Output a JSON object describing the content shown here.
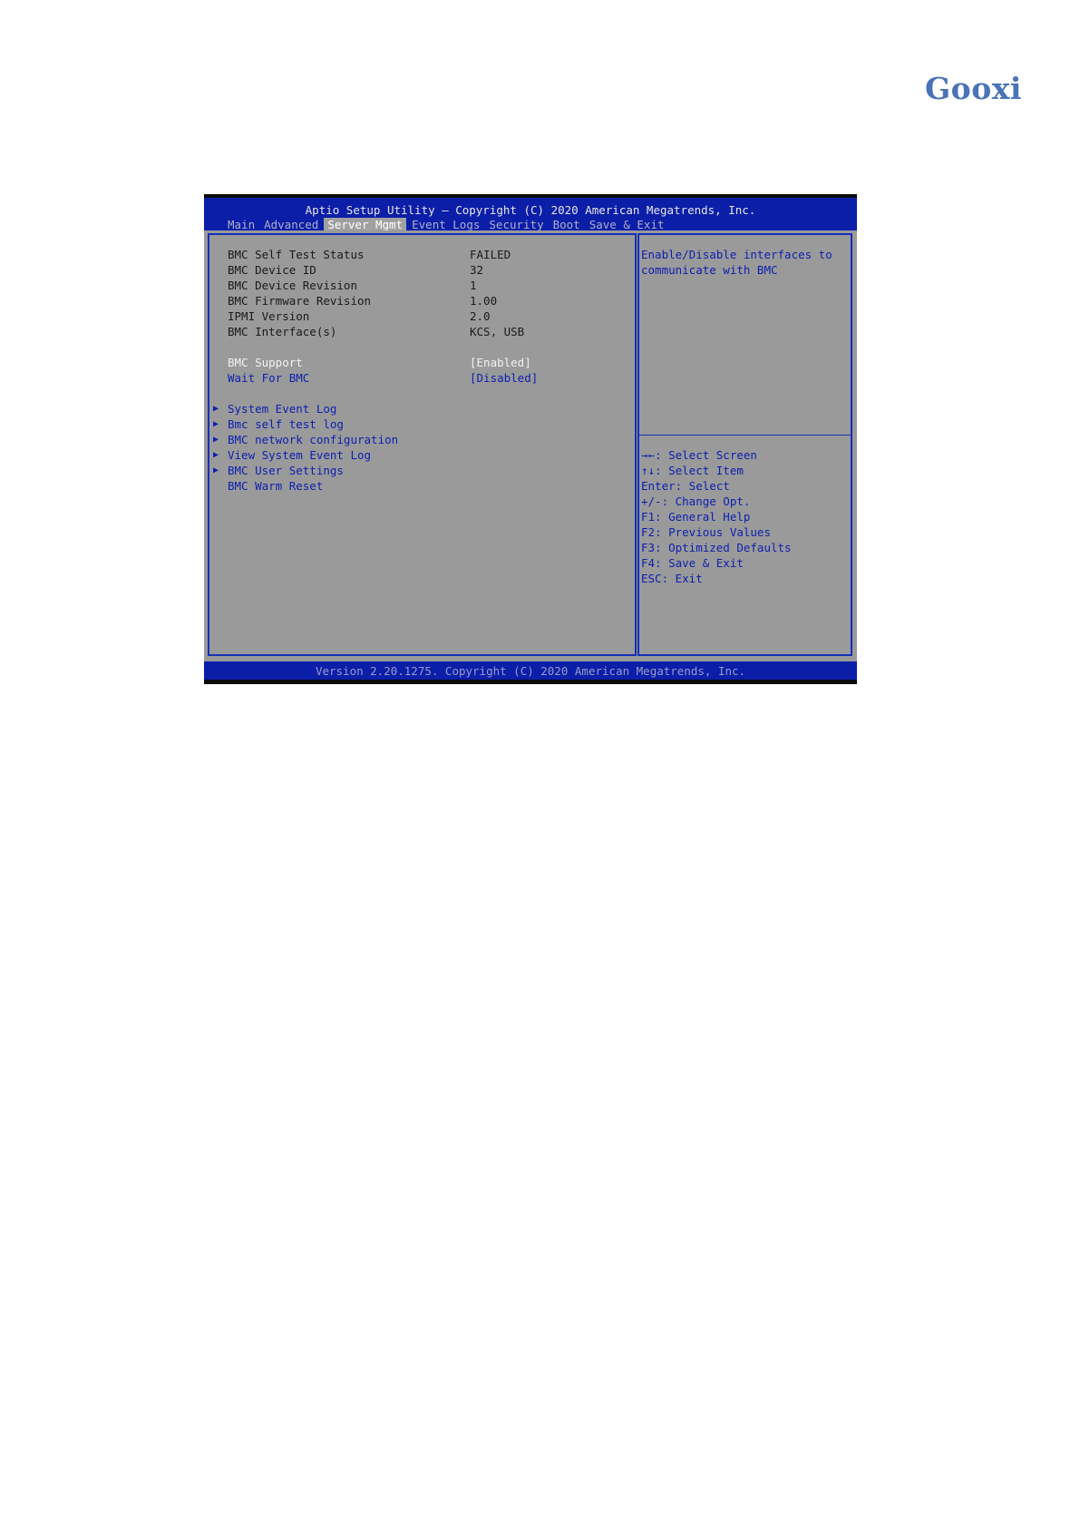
{
  "logo": "Gooxi",
  "header": {
    "title": "Aptio Setup Utility – Copyright (C) 2020 American Megatrends, Inc.",
    "tabs": [
      "Main",
      "Advanced",
      "Server Mgmt",
      "Event Logs",
      "Security",
      "Boot",
      "Save & Exit"
    ],
    "active_tab": "Server Mgmt"
  },
  "info_rows": [
    {
      "label": "BMC Self Test Status",
      "value": "FAILED"
    },
    {
      "label": "BMC Device ID",
      "value": "32"
    },
    {
      "label": "BMC Device Revision",
      "value": "1"
    },
    {
      "label": "BMC Firmware Revision",
      "value": "1.00"
    },
    {
      "label": "IPMI Version",
      "value": "2.0"
    },
    {
      "label": "BMC Interface(s)",
      "value": "KCS, USB"
    }
  ],
  "options": [
    {
      "label": "BMC Support",
      "value": "[Enabled]"
    },
    {
      "label": "Wait For BMC",
      "value": "[Disabled]"
    }
  ],
  "submenus": [
    "System Event Log",
    "Bmc self test log",
    "BMC network configuration",
    "View System Event Log",
    "BMC User Settings"
  ],
  "actions": [
    "BMC Warm Reset"
  ],
  "help": {
    "line1": "Enable/Disable interfaces to",
    "line2": "communicate with BMC"
  },
  "keys": [
    "→←: Select Screen",
    "↑↓: Select Item",
    "Enter: Select",
    "+/-: Change Opt.",
    "F1: General Help",
    "F2: Previous Values",
    "F3: Optimized Defaults",
    "F4: Save & Exit",
    "ESC: Exit"
  ],
  "footer": "Version 2.20.1275. Copyright (C) 2020 American Megatrends, Inc.",
  "colors": {
    "title_bar": "#0b1ea8",
    "body": "#9a9a9a",
    "link": "#0c1fb0",
    "logo": "#4a73b8"
  }
}
